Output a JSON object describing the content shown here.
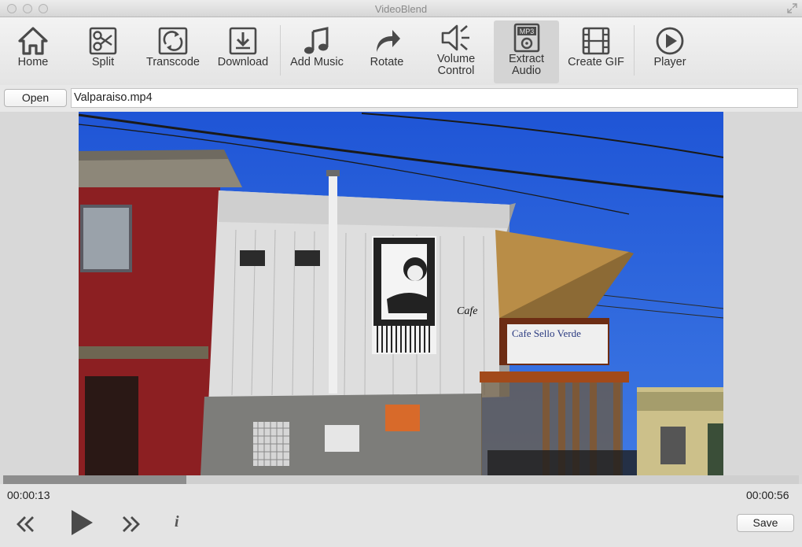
{
  "window": {
    "title": "VideoBlend"
  },
  "toolbar": {
    "items": [
      {
        "label": "Home",
        "icon": "home-icon"
      },
      {
        "label": "Split",
        "icon": "split-icon"
      },
      {
        "label": "Transcode",
        "icon": "transcode-icon"
      },
      {
        "label": "Download",
        "icon": "download-icon"
      },
      {
        "label": "Add Music",
        "icon": "music-note-icon"
      },
      {
        "label": "Rotate",
        "icon": "rotate-icon"
      },
      {
        "label": "Volume Control",
        "label_line1": "Volume",
        "label_line2": "Control",
        "icon": "speaker-icon"
      },
      {
        "label": "Extract Audio",
        "label_line1": "Extract",
        "label_line2": "Audio",
        "icon": "mp3-icon",
        "active": true,
        "icon_text": "MP3"
      },
      {
        "label": "Create GIF",
        "icon": "film-strip-icon"
      },
      {
        "label": "Player",
        "icon": "play-circle-icon"
      }
    ]
  },
  "file": {
    "open_label": "Open",
    "filename": "Valparaiso.mp4"
  },
  "video": {
    "sign_text": "Cafe",
    "banner_text": "Cafe Sello Verde"
  },
  "player": {
    "current_time": "00:00:13",
    "total_time": "00:00:56",
    "progress": 0.23,
    "info_label": "i",
    "save_label": "Save"
  }
}
